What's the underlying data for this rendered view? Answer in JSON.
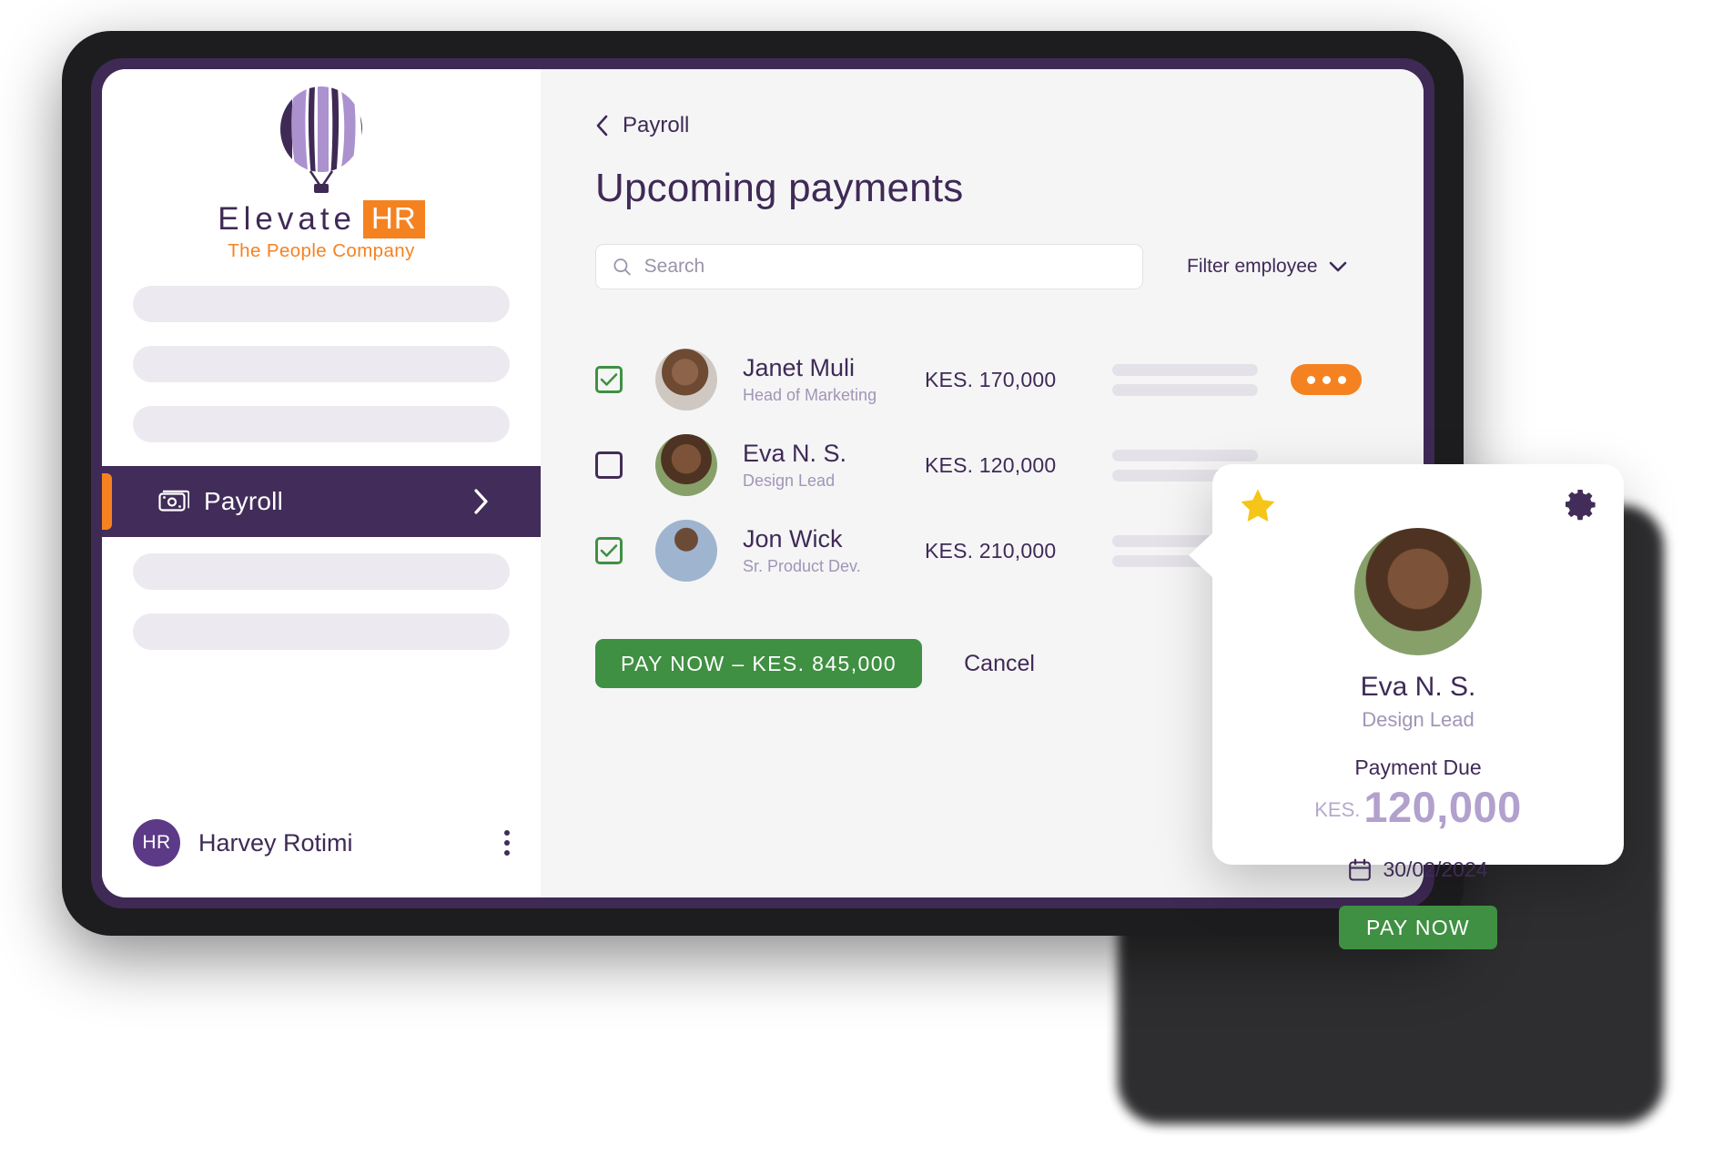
{
  "sidebar": {
    "logo": {
      "icon": "hot-air-balloon-icon",
      "word_mark": "Elevate",
      "badge": "HR",
      "tagline": "The People Company"
    },
    "nav_placeholder_count_top": 3,
    "nav_placeholder_count_bottom": 2,
    "active_item": {
      "label": "Payroll",
      "icon": "banknote-icon",
      "chevron": "chevron-right-icon"
    },
    "user": {
      "initials": "HR",
      "name": "Harvey Rotimi",
      "menu_icon": "kebab-menu-icon"
    }
  },
  "main": {
    "breadcrumb": {
      "back_icon": "chevron-left-icon",
      "label": "Payroll"
    },
    "title": "Upcoming payments",
    "search": {
      "icon": "search-icon",
      "placeholder": "Search",
      "value": ""
    },
    "filter": {
      "label": "Filter employee",
      "icon": "chevron-down-icon"
    },
    "rows": [
      {
        "checked": true,
        "name": "Janet Muli",
        "role": "Head of Marketing",
        "amount": "KES. 170,000",
        "avatar": "employee-photo-janet",
        "more_icon": "more-options-icon",
        "has_more_button": true
      },
      {
        "checked": false,
        "name": "Eva N. S.",
        "role": "Design Lead",
        "amount": "KES. 120,000",
        "avatar": "employee-photo-eva",
        "more_icon": "more-options-icon",
        "has_more_button": false
      },
      {
        "checked": true,
        "name": "Jon Wick",
        "role": "Sr. Product Dev.",
        "amount": "KES. 210,000",
        "avatar": "employee-photo-jon",
        "more_icon": "more-options-icon",
        "has_more_button": false
      }
    ],
    "actions": {
      "pay_label": "PAY NOW – KES. 845,000",
      "cancel_label": "Cancel"
    }
  },
  "popup": {
    "star_icon": "star-icon",
    "settings_icon": "gear-icon",
    "avatar": "employee-photo-eva",
    "name": "Eva N. S.",
    "role": "Design Lead",
    "due_label": "Payment Due",
    "currency": "KES.",
    "amount": "120,000",
    "date_icon": "calendar-icon",
    "date": "30/02/2024",
    "pay_label": "PAY NOW"
  },
  "colors": {
    "brand_purple": "#3f2a56",
    "nav_purple": "#422c59",
    "accent_orange": "#f58220",
    "green": "#3f9042",
    "star_yellow": "#f5c518",
    "light_purple": "#b2a0cd"
  }
}
